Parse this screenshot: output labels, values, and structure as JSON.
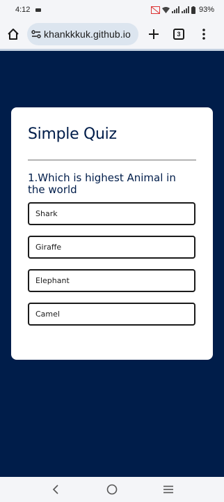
{
  "status": {
    "time": "4:12",
    "battery": "93%"
  },
  "browser": {
    "url": "khankkkuk.github.io",
    "tab_count": "3"
  },
  "quiz": {
    "title": "Simple Quiz",
    "question": "1.Which is highest Animal in the world",
    "answers": [
      "Shark",
      "Giraffe",
      "Elephant",
      "Camel"
    ]
  },
  "colors": {
    "page_background": "#001d4a",
    "card_background": "#ffffff",
    "text_primary": "#001d4a"
  },
  "icons": {
    "home": "home-icon",
    "site_settings": "tune-icon",
    "new_tab": "plus-icon",
    "tabs": "tab-switcher-icon",
    "menu": "more-vert-icon",
    "back": "chevron-left-icon",
    "home_nav": "circle-home-icon",
    "recents": "recents-icon"
  }
}
